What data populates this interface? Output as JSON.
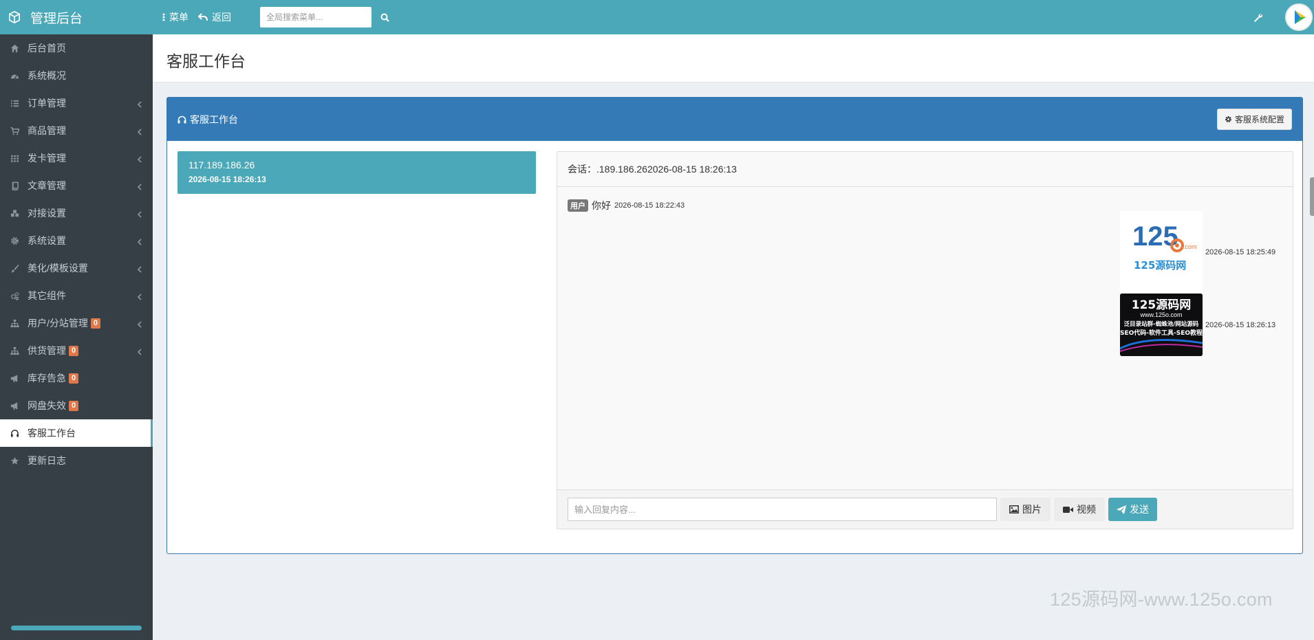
{
  "header": {
    "brand": "管理后台",
    "menu_label": "菜单",
    "back_label": "返回",
    "search_placeholder": "全局搜索菜单..."
  },
  "sidebar": {
    "items": [
      {
        "label": "后台首页",
        "icon": "home-icon",
        "has_submenu": false,
        "badge": ""
      },
      {
        "label": "系统概况",
        "icon": "dashboard-icon",
        "has_submenu": false,
        "badge": ""
      },
      {
        "label": "订单管理",
        "icon": "list-icon",
        "has_submenu": true,
        "badge": ""
      },
      {
        "label": "商品管理",
        "icon": "cart-icon",
        "has_submenu": true,
        "badge": ""
      },
      {
        "label": "发卡管理",
        "icon": "grid-icon",
        "has_submenu": true,
        "badge": ""
      },
      {
        "label": "文章管理",
        "icon": "book-icon",
        "has_submenu": true,
        "badge": ""
      },
      {
        "label": "对接设置",
        "icon": "cubes-icon",
        "has_submenu": true,
        "badge": ""
      },
      {
        "label": "系统设置",
        "icon": "gear-icon",
        "has_submenu": true,
        "badge": ""
      },
      {
        "label": "美化/模板设置",
        "icon": "brush-icon",
        "has_submenu": true,
        "badge": ""
      },
      {
        "label": "其它组件",
        "icon": "gears-icon",
        "has_submenu": true,
        "badge": ""
      },
      {
        "label": "用户/分站管理",
        "icon": "sitemap-icon",
        "has_submenu": true,
        "badge": "0"
      },
      {
        "label": "供货管理",
        "icon": "sitemap-icon",
        "has_submenu": true,
        "badge": "0"
      },
      {
        "label": "库存告急",
        "icon": "bullhorn-icon",
        "has_submenu": false,
        "badge": "0"
      },
      {
        "label": "网盘失效",
        "icon": "bullhorn-icon",
        "has_submenu": false,
        "badge": "0"
      },
      {
        "label": "客服工作台",
        "icon": "headphones-icon",
        "has_submenu": false,
        "badge": "",
        "active": true
      },
      {
        "label": "更新日志",
        "icon": "star-icon",
        "has_submenu": false,
        "badge": ""
      }
    ]
  },
  "page": {
    "title": "客服工作台",
    "panel_title": "客服工作台",
    "config_button": "客服系统配置"
  },
  "sessions": [
    {
      "ip": "117.189.186.26",
      "time": "2026-08-15 18:26:13"
    }
  ],
  "chat": {
    "header": "会话：.189.186.262026-08-15 18:26:13",
    "messages": [
      {
        "from": "user",
        "tag": "用户",
        "text": "你好",
        "time": "2026-08-15 18:22:43"
      },
      {
        "from": "agent",
        "type": "image",
        "image": "logo-125",
        "time": "2026-08-15 18:25:49"
      },
      {
        "from": "agent",
        "type": "image",
        "image": "banner-125",
        "time": "2026-08-15 18:26:13"
      }
    ],
    "input_placeholder": "输入回复内容...",
    "image_btn": "图片",
    "video_btn": "视频",
    "send_btn": "发送"
  },
  "images": {
    "logo_text_num": "125",
    "logo_text_com": ".com",
    "logo_text_cn": "125源码网",
    "banner_title": "125源码网",
    "banner_url": "www.125o.com",
    "banner_line1": "泛目录站群-蜘蛛池/网站源码",
    "banner_line2": "SEO代码-软件工具-SEO教程"
  },
  "watermark": "125源码网-www.125o.com",
  "colors": {
    "header": "#4aa8b9",
    "sidebar": "#373f46",
    "panel": "#337ab7",
    "badge": "#e0784a"
  }
}
